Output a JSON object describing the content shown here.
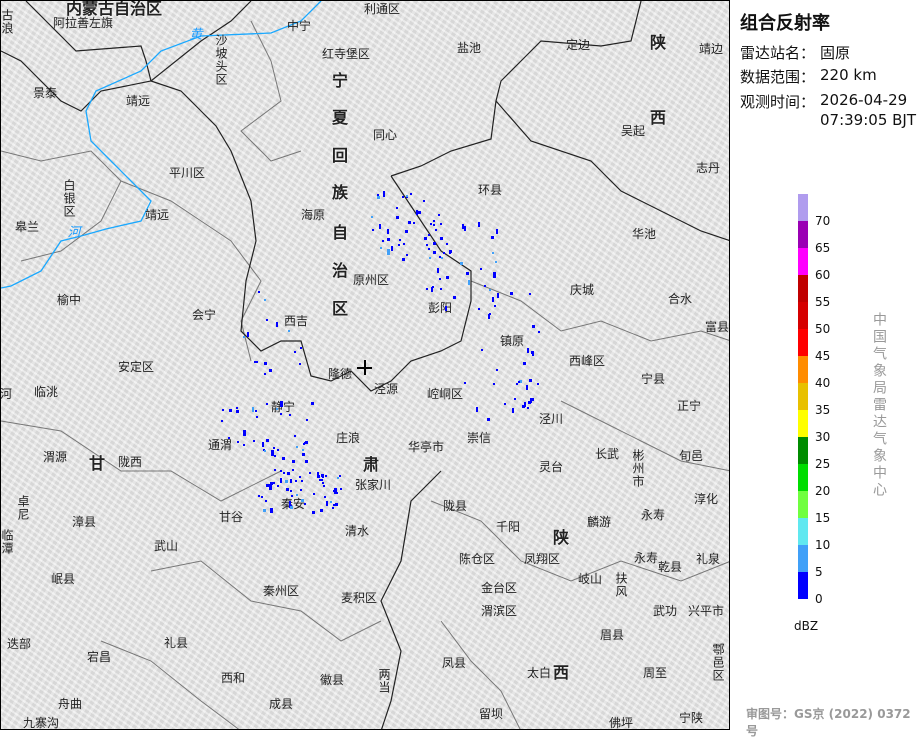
{
  "map": {
    "provinces": [
      "内蒙古自治区",
      "宁",
      "夏",
      "回",
      "族",
      "自",
      "治",
      "区",
      "陕",
      "西",
      "甘",
      "肃",
      "陕",
      "西"
    ],
    "rivers": [
      "黄",
      "河"
    ],
    "labels": [
      "阿拉善左旗",
      "利通区",
      "中宁",
      "沙坡头区",
      "红寺堡区",
      "盐池",
      "定边",
      "靖边",
      "景泰",
      "靖远",
      "同心",
      "吴起",
      "志丹",
      "平川区",
      "环县",
      "白银区",
      "海原",
      "靖远",
      "皋兰",
      "华池",
      "原州区",
      "彭阳",
      "庆城",
      "合水",
      "榆中",
      "会宁",
      "西吉",
      "镇原",
      "富县",
      "安定区",
      "西峰区",
      "隆德",
      "泾源",
      "宁县",
      "临洮",
      "崆峒区",
      "静宁",
      "正宁",
      "泾川",
      "通渭",
      "庄浪",
      "华亭市",
      "崇信",
      "长武",
      "旬邑",
      "渭源",
      "陇西",
      "灵台",
      "彬州市",
      "张家川",
      "秦安",
      "陇县",
      "淳化",
      "卓尼",
      "漳县",
      "甘谷",
      "麟游",
      "永寿",
      "清水",
      "千阳",
      "临潭",
      "武山",
      "陈仓区",
      "凤翔区",
      "永寿",
      "乾县",
      "礼泉",
      "岷县",
      "岐山",
      "扶风",
      "秦州区",
      "麦积区",
      "金台区",
      "渭滨区",
      "武功",
      "兴平市",
      "迭部",
      "礼县",
      "宕昌",
      "眉县",
      "鄠邑区",
      "西和",
      "徽县",
      "两当",
      "凤县",
      "太白",
      "周至",
      "舟曲",
      "成县",
      "留坝",
      "佛坪",
      "宁陕",
      "九寨沟",
      "古浪",
      "河"
    ]
  },
  "panel": {
    "title": "组合反射率",
    "station_label": "雷达站名：",
    "station": "固原",
    "range_label": "数据范围：",
    "range": "220 km",
    "time_label": "观测时间：",
    "date": "2026-04-29",
    "time": "07:39:05 BJT",
    "colorbar": {
      "colors": [
        "#b09cee",
        "#9a00b4",
        "#ff00ff",
        "#c00000",
        "#d60000",
        "#ff0000",
        "#ff8c00",
        "#e8c000",
        "#ffff00",
        "#008c00",
        "#00dd00",
        "#70ff40",
        "#60e8f0",
        "#40a0f8",
        "#0000ff"
      ],
      "ticks": [
        "70",
        "65",
        "60",
        "55",
        "50",
        "45",
        "40",
        "35",
        "30",
        "25",
        "20",
        "15",
        "10",
        "5",
        "0"
      ],
      "unit": "dBZ"
    },
    "watermark": "中国气象局雷达气象中心",
    "footer": "审图号：GS京 (2022) 0372号"
  }
}
